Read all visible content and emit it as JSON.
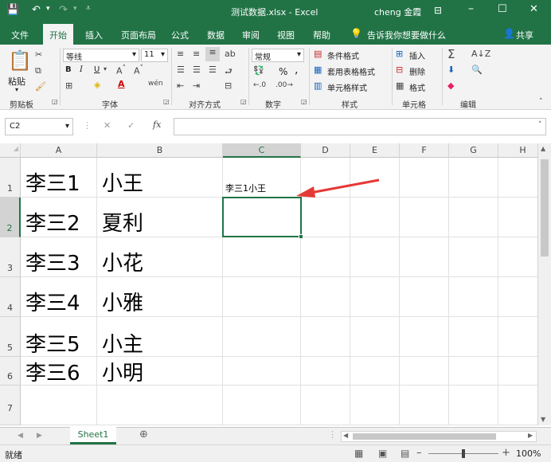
{
  "window": {
    "title": "测试数据.xlsx - Excel",
    "user": "cheng 金霞",
    "accent": "#217346"
  },
  "tabs": [
    "文件",
    "开始",
    "插入",
    "页面布局",
    "公式",
    "数据",
    "审阅",
    "视图",
    "帮助"
  ],
  "active_tab": "开始",
  "tell_me": "告诉我你想要做什么",
  "share": "共享",
  "ribbon": {
    "paste": "粘贴",
    "font_name": "等线",
    "font_size": "11",
    "number_format": "常规",
    "styles": [
      "条件格式",
      "套用表格格式",
      "单元格样式"
    ],
    "cells": [
      "插入",
      "删除",
      "格式"
    ],
    "bold": "B",
    "italic": "I",
    "underline": "U",
    "percent": "%",
    "comma": ",",
    "groups": [
      "剪贴板",
      "字体",
      "对齐方式",
      "数字",
      "样式",
      "单元格",
      "编辑"
    ]
  },
  "formula_bar": {
    "name_box": "C2",
    "fx": "fx",
    "cancel": "✕",
    "enter": "✓",
    "value": ""
  },
  "columns": [
    "A",
    "B",
    "C",
    "D",
    "E",
    "F",
    "G",
    "H"
  ],
  "rows": [
    {
      "num": "1",
      "a": "李三1",
      "b": "小王",
      "c": "李三1小王"
    },
    {
      "num": "2",
      "a": "李三2",
      "b": "夏利",
      "c": ""
    },
    {
      "num": "3",
      "a": "李三3",
      "b": "小花",
      "c": ""
    },
    {
      "num": "4",
      "a": "李三4",
      "b": "小雅",
      "c": ""
    },
    {
      "num": "5",
      "a": "李三5",
      "b": "小主",
      "c": ""
    },
    {
      "num": "6",
      "a": "李三6",
      "b": "小明",
      "c": ""
    },
    {
      "num": "7",
      "a": "",
      "b": "",
      "c": ""
    }
  ],
  "selected_cell": "C2",
  "sheet_tab": "Sheet1",
  "status": {
    "ready": "就绪",
    "zoom": "100%"
  }
}
